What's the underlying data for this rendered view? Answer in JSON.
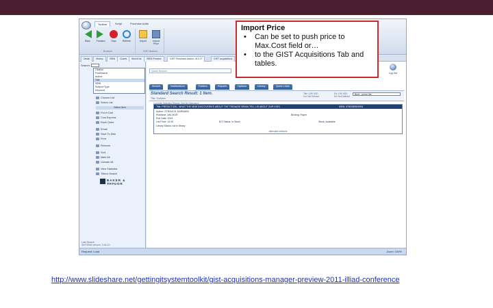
{
  "slide": {
    "url": "http://www.slideshare.net/gettingitsystemtoolkit/gist-acquisitions-manager-preview-2011-illiad-conference"
  },
  "app": {
    "ribbon_tabs": [
      "Toolbar",
      "Script",
      "Purchase Adds"
    ],
    "ribbon_groups": [
      {
        "label": "Browser",
        "buttons": [
          "Back",
          "Forward",
          "Stop",
          "Refresh"
        ]
      },
      {
        "label": "GIST Buttons",
        "buttons": [
          "Import",
          "Import Price"
        ]
      }
    ],
    "doc_tabs": [
      "Detail",
      "History",
      "ISBN",
      "Charts",
      "WorldCat",
      "ISBN Preview",
      "GIST Purchase Addon: 413 17",
      "GIST acquisitions"
    ],
    "sidebar": {
      "search_label": "Search:",
      "search_value": "Title",
      "dropdown_options": [
        "Citation",
        "FindSearch",
        "Author",
        "Title",
        "ISBN",
        "Subject Type",
        "Keyword"
      ],
      "items_top": [
        "Choose List",
        "Select List"
      ],
      "section_head": "Select Item",
      "items": [
        "Put in Cart",
        "Cost Express",
        "Rush Order",
        "Email",
        "Save To Disk",
        "Print",
        "Remove",
        "Sort",
        "Mark All",
        "Unmark All",
        "View Statistics",
        "Titlexo Search"
      ],
      "logo_text": "BAKER & TAYLOR",
      "logo_sub": "Title Source 3",
      "footer_lines": [
        "Last Search",
        "SISTEMA Version: 3.45.10"
      ]
    },
    "main": {
      "search_label": "Quick Search",
      "tabs": [
        "Search",
        "Notifications",
        "Folders",
        "Reports",
        "Options",
        "Library",
        "Quick Links"
      ],
      "lognav_label": "Log Out",
      "result_title": "Standard Search Result: 1 Item.",
      "result_sub": "Title: TheWeb",
      "result_note": "Currently Selecting Results, Sort By Relevance",
      "result_mid": [
        "Title: 3.99 USD",
        "Vol: Not Defined",
        "Ed: 3.99 USD",
        "Ed: Not Defined"
      ],
      "view_select": "Brief - prime list",
      "record_lines": [
        "Title: PREDICTION - WHAT THE NEW DISCOVERIES ABOUT THE TEENAGE BRAIN TELL US ABOUT OUR KIDS.",
        "Author: STRAUCH, BARBARA",
        "Publisher: ANCHOR",
        "Pub Date: 2004",
        "List Price: 14.00",
        "B/T Status: In Stock",
        "Library Status: not in library"
      ],
      "record_right": [
        "ISBN: 9780385509251",
        "Binding: Paper",
        "Stock: Available"
      ],
      "alt_editions": "alternate editions"
    },
    "status_left": "Request: Load",
    "status_right": "Zoom: 100%"
  },
  "callout": {
    "title": "Import Price",
    "bullets": [
      "Can be set to push price to Max.Cost field or…",
      "to the GIST Acquisitions Tab and tables."
    ]
  }
}
